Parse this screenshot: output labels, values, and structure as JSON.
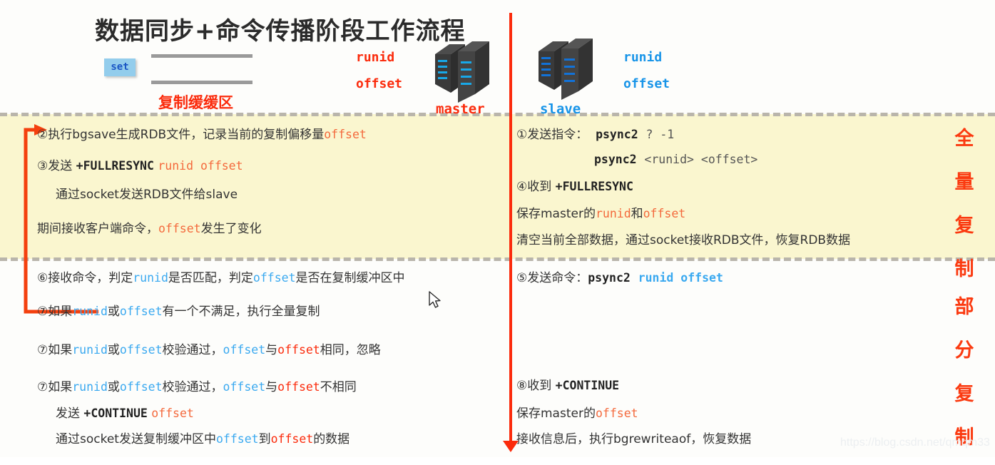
{
  "title": "数据同步+命令传播阶段工作流程",
  "header": {
    "set_label": "set",
    "buffer_label": "复制缓缓区",
    "master": {
      "name": "master",
      "runid": "runid",
      "offset": "offset"
    },
    "slave": {
      "name": "slave",
      "runid": "runid",
      "offset": "offset"
    }
  },
  "bands": {
    "full": {
      "vertical_label": [
        "全",
        "量",
        "复",
        "制"
      ]
    },
    "partial": {
      "vertical_label": [
        "部",
        "分",
        "复",
        "制"
      ]
    }
  },
  "master_side": {
    "full": [
      {
        "num": "②",
        "text": "执行bgsave生成RDB文件，记录当前的复制偏移量",
        "tail_red": "offset"
      },
      {
        "num": "③",
        "text": "发送 ",
        "cmd": "+FULLRESYNC",
        "args": "runid offset"
      },
      {
        "num": "",
        "text": "通过socket发送RDB文件给slave"
      },
      {
        "num": "",
        "text": "期间接收客户端命令，",
        "mid_red": "offset",
        "text2": "发生了变化"
      }
    ],
    "partial": [
      {
        "num": "⑥",
        "a": "接收命令，判定",
        "b1": "runid",
        "c": "是否匹配，判定",
        "b2": "offset",
        "d": "是否在复制缓冲区中"
      },
      {
        "num": "⑦",
        "a": "如果",
        "b1": "runid",
        "c": "或",
        "b2": "offset",
        "d": "有一个不满足，执行全量复制"
      },
      {
        "num": "⑦",
        "a": "如果",
        "b1": "runid",
        "c": "或",
        "b2": "offset",
        "d": "校验通过，",
        "e": "offset",
        "f": "与",
        "g": "offset",
        "h": "相同，忽略"
      },
      {
        "num": "⑦",
        "a": "如果",
        "b1": "runid",
        "c": "或",
        "b2": "offset",
        "d": "校验通过，",
        "e": "offset",
        "f": "与",
        "g": "offset",
        "h": "不相同"
      },
      {
        "num": "",
        "text": "发送 ",
        "cmd": "+CONTINUE",
        "args": "offset"
      },
      {
        "num": "",
        "a": "通过socket发送复制缓冲区中",
        "b1": "offset",
        "c": "到",
        "b2": "offset",
        "d": "的数据"
      }
    ]
  },
  "slave_side": {
    "full": [
      {
        "num": "①",
        "text": "发送指令：",
        "cmd": "psync2",
        "args": "? -1"
      },
      {
        "num": "",
        "cmd": "psync2",
        "args": "<runid> <offset>"
      },
      {
        "num": "④",
        "text": "收到 ",
        "cmd": "+FULLRESYNC"
      },
      {
        "num": "",
        "a": "保存master的",
        "b1": "runid",
        "c": "和",
        "b2": "offset"
      },
      {
        "num": "",
        "text": "清空当前全部数据，通过socket接收RDB文件，恢复RDB数据"
      }
    ],
    "partial": [
      {
        "num": "⑤",
        "text": "发送命令：",
        "cmd": "psync2",
        "args": "runid offset"
      },
      {
        "num": "⑧",
        "text": "收到 ",
        "cmd": "+CONTINUE"
      },
      {
        "num": "",
        "a": "保存master的",
        "b1": "offset"
      },
      {
        "num": "",
        "text": "接收信息后，执行bgrewriteaof，恢复数据"
      }
    ]
  },
  "watermark": "https://blog.csdn.net/qmqm33",
  "colors": {
    "band": "#faf6cf",
    "red": "#fb2b0c",
    "blue": "#1794e8",
    "orange": "#f4693c",
    "light_blue": "#3aa9f0",
    "set_bg": "#93cdec"
  }
}
